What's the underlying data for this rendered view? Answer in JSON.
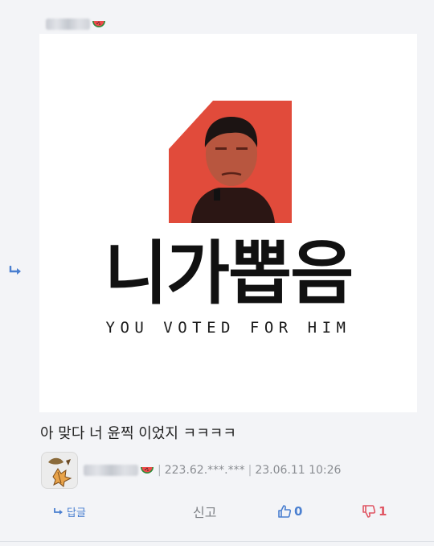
{
  "post": {
    "author_badge_icon": "watermelon-icon",
    "image": {
      "title": "니가뽑음",
      "subtitle": "YOU VOTED FOR HIM"
    }
  },
  "comment": {
    "text": "아 맞다 너 윤찍 이었지 ㅋㅋㅋㅋ",
    "ip": "223.62.***.***",
    "date": "23.06.11 10:26",
    "author_badge_icon": "watermelon-icon",
    "avatar_icon": "autumn-leaves-icon"
  },
  "actions": {
    "reply_label": "답글",
    "report_label": "신고",
    "like_count": "0",
    "dislike_count": "1"
  },
  "colors": {
    "accent_blue": "#4a7fd0",
    "accent_red": "#e05563",
    "logo_red": "#e14b3b"
  }
}
